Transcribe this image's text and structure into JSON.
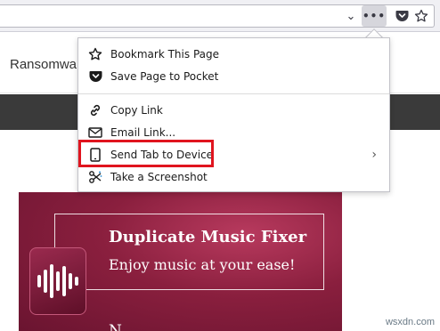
{
  "site": {
    "name": "Ransomwa"
  },
  "toolbar": {
    "chevron_glyph": "⌄",
    "more_glyph": "•••"
  },
  "menu": {
    "items": [
      {
        "label": "Bookmark This Page",
        "icon": "star-icon"
      },
      {
        "label": "Save Page to Pocket",
        "icon": "pocket-icon"
      },
      {
        "label": "Copy Link",
        "icon": "link-icon"
      },
      {
        "label": "Email Link...",
        "icon": "envelope-icon"
      },
      {
        "label": "Send Tab to Device",
        "icon": "device-icon",
        "has_submenu": true
      },
      {
        "label": "Take a Screenshot",
        "icon": "scissors-icon"
      }
    ],
    "submenu_glyph": "›",
    "highlight_color": "#e0141e"
  },
  "banner": {
    "title": "Duplicate Music Fixer",
    "subtitle": "Enjoy music at your ease!",
    "more_text": "N"
  },
  "watermark": "wsxdn.com",
  "colors": {
    "banner": "#8a1f3e",
    "dark_band": "#3a3a3a",
    "toolbar": "#f0f0f4"
  }
}
